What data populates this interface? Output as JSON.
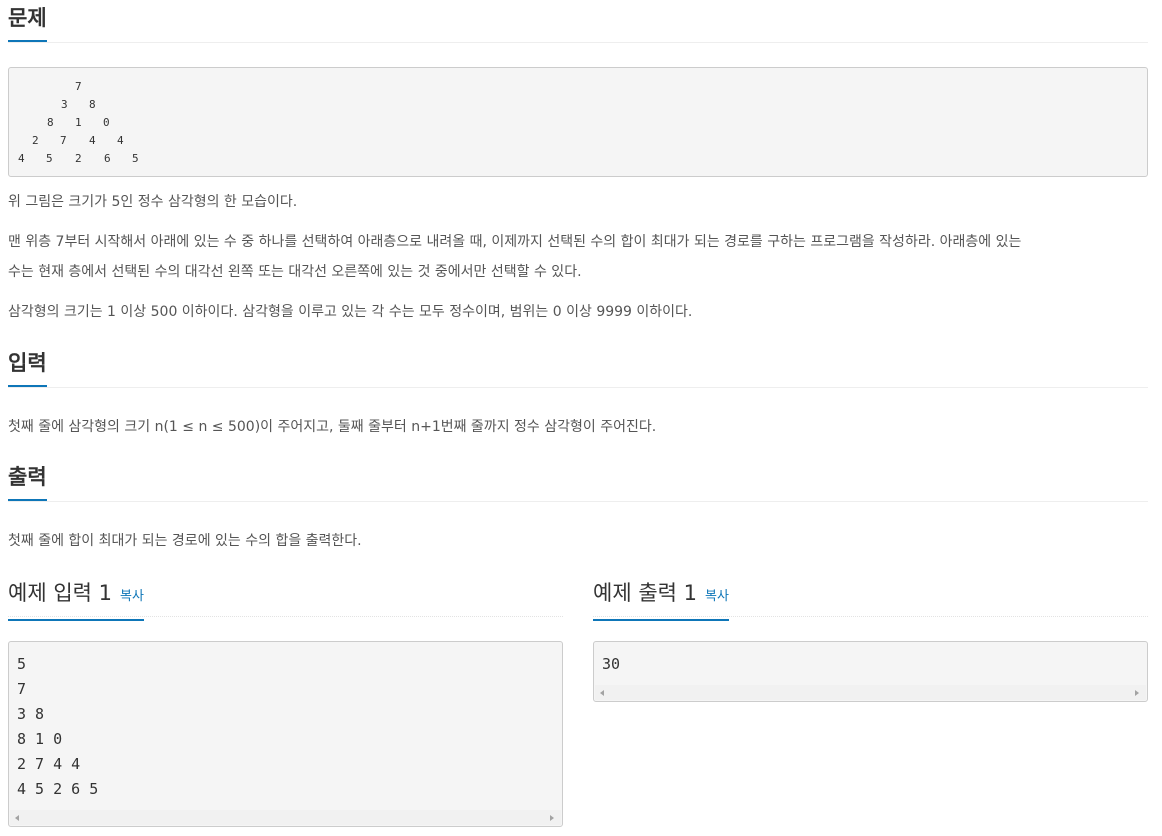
{
  "problem": {
    "title": "문제",
    "triangle_rows": [
      [
        "7"
      ],
      [
        "3",
        "8"
      ],
      [
        "8",
        "1",
        "0"
      ],
      [
        "2",
        "7",
        "4",
        "4"
      ],
      [
        "4",
        "5",
        "2",
        "6",
        "5"
      ]
    ],
    "paragraphs": [
      "위 그림은 크기가 5인 정수 삼각형의 한 모습이다.",
      "맨 위층 7부터 시작해서 아래에 있는 수 중 하나를 선택하여 아래층으로 내려올 때, 이제까지 선택된 수의 합이 최대가 되는 경로를 구하는 프로그램을 작성하라. 아래층에 있는",
      "수는 현재 층에서 선택된 수의 대각선 왼쪽 또는 대각선 오른쪽에 있는 것 중에서만 선택할 수 있다.",
      "삼각형의 크기는 1 이상 500 이하이다. 삼각형을 이루고 있는 각 수는 모두 정수이며, 범위는 0 이상 9999 이하이다."
    ]
  },
  "input": {
    "title": "입력",
    "text": "첫째 줄에 삼각형의 크기 n(1 ≤ n ≤ 500)이 주어지고, 둘째 줄부터 n+1번째 줄까지 정수 삼각형이 주어진다."
  },
  "output": {
    "title": "출력",
    "text": "첫째 줄에 합이 최대가 되는 경로에 있는 수의 합을 출력한다."
  },
  "sample_input": {
    "title": "예제 입력 1",
    "copy_label": "복사",
    "lines": [
      "5",
      "7",
      "3 8",
      "8 1 0",
      "2 7 4 4",
      "4 5 2 6 5"
    ]
  },
  "sample_output": {
    "title": "예제 출력 1",
    "copy_label": "복사",
    "lines": [
      "30"
    ]
  },
  "colors": {
    "accent": "#0e76b8",
    "text": "#555555",
    "box_bg": "#f5f5f5",
    "box_border": "#cccccc"
  }
}
